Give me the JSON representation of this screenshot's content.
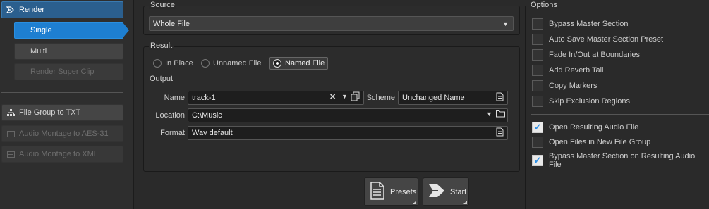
{
  "sidebar": {
    "render_label": "Render",
    "single_label": "Single",
    "multi_label": "Multi",
    "super_clip_label": "Render Super Clip",
    "tools": [
      {
        "label": "File Group to TXT"
      },
      {
        "label": "Audio Montage to AES-31"
      },
      {
        "label": "Audio Montage to XML"
      }
    ]
  },
  "source": {
    "title": "Source",
    "value": "Whole File"
  },
  "result": {
    "title": "Result",
    "radios": [
      {
        "label": "In Place",
        "selected": false
      },
      {
        "label": "Unnamed File",
        "selected": false
      },
      {
        "label": "Named File",
        "selected": true
      }
    ]
  },
  "output": {
    "title": "Output",
    "name_label": "Name",
    "name_value": "track-1",
    "scheme_label": "Scheme",
    "scheme_value": "Unchanged Name",
    "location_label": "Location",
    "location_value": "C:\\Music",
    "format_label": "Format",
    "format_value": "Wav default"
  },
  "options": {
    "title": "Options",
    "items": [
      {
        "label": "Bypass Master Section",
        "checked": false
      },
      {
        "label": "Auto Save Master Section Preset",
        "checked": false
      },
      {
        "label": "Fade In/Out at Boundaries",
        "checked": false
      },
      {
        "label": "Add Reverb Tail",
        "checked": false
      },
      {
        "label": "Copy Markers",
        "checked": false
      },
      {
        "label": "Skip Exclusion Regions",
        "checked": false
      },
      {
        "label": "Open Resulting Audio File",
        "checked": true
      },
      {
        "label": "Open Files in New File Group",
        "checked": false
      },
      {
        "label": "Bypass Master Section on Resulting Audio File",
        "checked": true
      }
    ]
  },
  "actions": {
    "presets_label": "Presets",
    "start_label": "Start"
  },
  "colors": {
    "accent": "#1e7fd1",
    "render_button": "#2b5f8e",
    "background": "#2a2a2a"
  }
}
